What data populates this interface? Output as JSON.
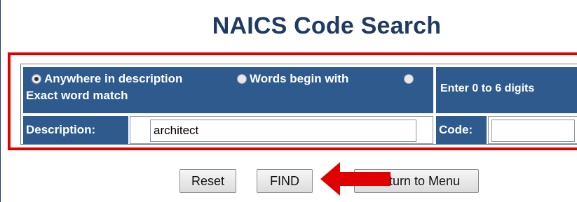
{
  "page": {
    "title": "NAICS Code Search"
  },
  "search_options": {
    "options": [
      {
        "label": "Anywhere in description",
        "selected": true
      },
      {
        "label": "Words begin with",
        "selected": false
      },
      {
        "label": "Exact word match",
        "selected": false
      }
    ],
    "code_hint": "Enter 0 to 6 digits"
  },
  "fields": {
    "description_label": "Description:",
    "description_value": "architect",
    "code_label": "Code:",
    "code_value": ""
  },
  "buttons": {
    "reset": "Reset",
    "find": "FIND",
    "return": "Return to Menu"
  },
  "colors": {
    "header_blue": "#2e5a8e",
    "title_blue": "#1f3a63",
    "annotation_red": "#e00000"
  },
  "icons": {
    "annotation": "red-arrow-icon"
  }
}
